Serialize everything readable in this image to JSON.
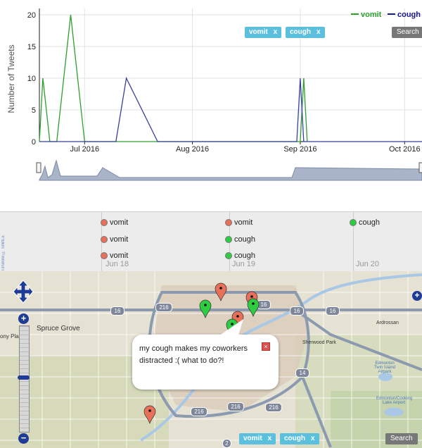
{
  "chart_data": {
    "type": "line",
    "ylabel": "Number of Tweets",
    "yticks": [
      0,
      5,
      10,
      15,
      20
    ],
    "xticks": [
      "Jul 2016",
      "Aug 2016",
      "Sep 2016",
      "Oct 2016"
    ],
    "x_range": [
      "2016-06-18",
      "2016-10-06"
    ],
    "y_range": [
      0,
      21
    ],
    "legend": [
      "vomit",
      "cough"
    ],
    "legend_position": "top-right",
    "series": [
      {
        "name": "vomit",
        "color": "#2ca02c",
        "points": [
          [
            "2016-06-18",
            0
          ],
          [
            "2016-06-19",
            10
          ],
          [
            "2016-06-21",
            0
          ],
          [
            "2016-06-23",
            0
          ],
          [
            "2016-06-27",
            20
          ],
          [
            "2016-07-01",
            0
          ],
          [
            "2016-09-01",
            0
          ],
          [
            "2016-09-02",
            10
          ],
          [
            "2016-09-03",
            0
          ]
        ]
      },
      {
        "name": "cough",
        "color": "#3a3f9e",
        "points": [
          [
            "2016-06-18",
            0
          ],
          [
            "2016-07-10",
            0
          ],
          [
            "2016-07-13",
            10
          ],
          [
            "2016-07-22",
            0
          ],
          [
            "2016-08-31",
            0
          ],
          [
            "2016-09-01",
            10
          ],
          [
            "2016-09-02",
            0
          ],
          [
            "2016-10-06",
            0
          ]
        ]
      }
    ]
  },
  "filters": {
    "tags": [
      {
        "label": "vomit",
        "close": "x"
      },
      {
        "label": "cough",
        "close": "x"
      }
    ],
    "search_label": "Search"
  },
  "timeline": {
    "credit": "Timeline © SIMILE",
    "dates": [
      "Jun 18",
      "Jun 19",
      "Jun 20"
    ],
    "events": [
      {
        "label": "vomit",
        "kind": "vomit",
        "color": "#e8705a"
      },
      {
        "label": "vomit",
        "kind": "vomit",
        "color": "#e8705a"
      },
      {
        "label": "vomit",
        "kind": "vomit",
        "color": "#e8705a"
      },
      {
        "label": "vomit",
        "kind": "vomit",
        "color": "#e8705a"
      },
      {
        "label": "cough",
        "kind": "cough",
        "color": "#2ecc40"
      },
      {
        "label": "cough",
        "kind": "cough",
        "color": "#2ecc40"
      },
      {
        "label": "cough",
        "kind": "cough",
        "color": "#2ecc40"
      }
    ]
  },
  "map": {
    "labels": [
      "Spruce Grove",
      "Ardrossan",
      "Sherwood Park",
      "Edmonton Twin Island Airpark",
      "Edmonton/Cooking Lake Airport",
      "ony Plain"
    ],
    "highway_numbers": [
      "16",
      "216",
      "16",
      "16",
      "16",
      "14",
      "216",
      "216",
      "216",
      "2"
    ],
    "popup_text": "my cough makes my coworkers distracted :( what to do?!",
    "popup_close": "×",
    "marker_colors": {
      "vomit": "#e8705a",
      "cough": "#2ecc40"
    },
    "markers": [
      {
        "kind": "vomit"
      },
      {
        "kind": "vomit"
      },
      {
        "kind": "vomit"
      },
      {
        "kind": "vomit"
      },
      {
        "kind": "cough"
      },
      {
        "kind": "cough"
      },
      {
        "kind": "cough"
      }
    ],
    "filters": {
      "tags": [
        {
          "label": "vomit",
          "close": "x"
        },
        {
          "label": "cough",
          "close": "x"
        }
      ],
      "search_label": "Search"
    }
  }
}
